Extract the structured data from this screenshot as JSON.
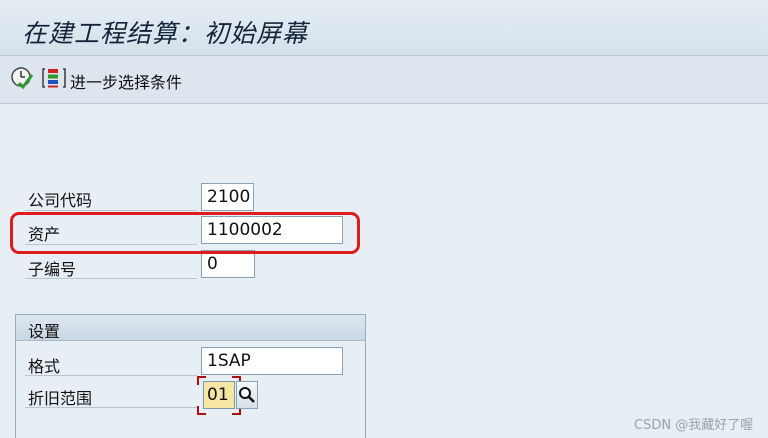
{
  "window": {
    "title": "在建工程结算：初始屏幕"
  },
  "toolbar": {
    "more_selections_label": "进一步选择条件"
  },
  "fields": {
    "company_code": {
      "label": "公司代码",
      "value": "2100"
    },
    "asset": {
      "label": "资产",
      "value": "1100002"
    },
    "sub_number": {
      "label": "子编号",
      "value": "0"
    }
  },
  "settings_group": {
    "title": "设置",
    "layout": {
      "label": "格式",
      "value": "1SAP"
    },
    "depreciation_area": {
      "label": "折旧范围",
      "value": "01"
    }
  },
  "watermark": "CSDN @我藏好了喔",
  "colors": {
    "highlight_box": "#e01b1b",
    "focused_field_background": "#f6e6a6",
    "execute_icon_green": "#2e9a2e"
  },
  "icons": {
    "execute": "execute-clock-icon",
    "multiple_selection": "multiple-selection-icon",
    "search_help": "magnifier-search-icon"
  }
}
